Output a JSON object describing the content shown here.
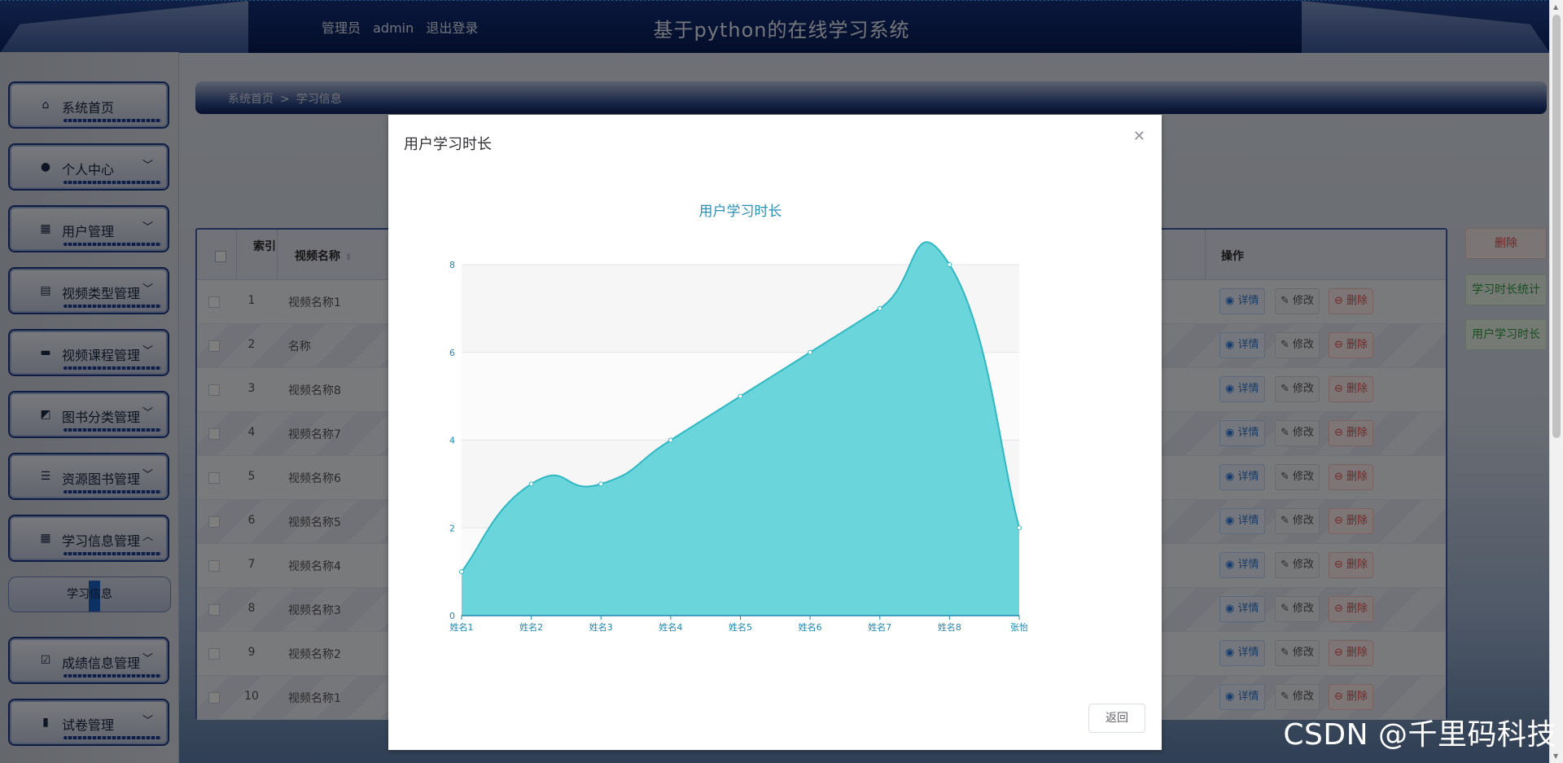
{
  "header": {
    "role": "管理员",
    "username": "admin",
    "logout": "退出登录",
    "title": "基于python的在线学习系统"
  },
  "sidebar": {
    "items": [
      {
        "label": "系统首页",
        "icon": "home-icon",
        "arrow": ""
      },
      {
        "label": "个人中心",
        "icon": "user-icon",
        "arrow": "﹀"
      },
      {
        "label": "用户管理",
        "icon": "grid-icon",
        "arrow": "﹀"
      },
      {
        "label": "视频类型管理",
        "icon": "clipboard-icon",
        "arrow": "﹀"
      },
      {
        "label": "视频课程管理",
        "icon": "monitor-icon",
        "arrow": "﹀"
      },
      {
        "label": "图书分类管理",
        "icon": "chart-icon",
        "arrow": "﹀"
      },
      {
        "label": "资源图书管理",
        "icon": "list-icon",
        "arrow": "﹀"
      },
      {
        "label": "学习信息管理",
        "icon": "grid-icon",
        "arrow": "︿"
      },
      {
        "label": "成绩信息管理",
        "icon": "check-clipboard-icon",
        "arrow": "﹀"
      },
      {
        "label": "试卷管理",
        "icon": "bar-chart-icon",
        "arrow": "﹀"
      }
    ],
    "active_sub": "学习信息"
  },
  "breadcrumb": {
    "home": "系统首页",
    "sep": ">",
    "current": "学习信息"
  },
  "table": {
    "columns": {
      "index": "索引",
      "name": "视频名称",
      "ops": "操作"
    },
    "rows": [
      {
        "index": "1",
        "name": "视频名称1"
      },
      {
        "index": "2",
        "name": "名称"
      },
      {
        "index": "3",
        "name": "视频名称8"
      },
      {
        "index": "4",
        "name": "视频名称7"
      },
      {
        "index": "5",
        "name": "视频名称6"
      },
      {
        "index": "6",
        "name": "视频名称5"
      },
      {
        "index": "7",
        "name": "视频名称4"
      },
      {
        "index": "8",
        "name": "视频名称3"
      },
      {
        "index": "9",
        "name": "视频名称2"
      },
      {
        "index": "10",
        "name": "视频名称1"
      }
    ],
    "actions": {
      "detail": "详情",
      "edit": "修改",
      "delete": "删除"
    }
  },
  "side_buttons": {
    "delete": "删除",
    "stats": "学习时长统计",
    "user_duration": "用户学习时长"
  },
  "dialog": {
    "title": "用户学习时长",
    "back_button": "返回"
  },
  "chart_data": {
    "type": "area",
    "title": "用户学习时长",
    "categories": [
      "姓名1",
      "姓名2",
      "姓名3",
      "姓名4",
      "姓名5",
      "姓名6",
      "姓名7",
      "姓名8",
      "张怡"
    ],
    "values": [
      1,
      3,
      3,
      4,
      5,
      6,
      7,
      8,
      2
    ],
    "ylim": [
      0,
      8
    ],
    "yticks": [
      "0",
      "2",
      "4",
      "6",
      "8"
    ],
    "grid": true,
    "smooth": true,
    "colors": {
      "fill": "#6ad6db",
      "line": "#2fb8c2",
      "title": "#2a8fb4",
      "axis": "#1f86b0"
    }
  },
  "watermark": "CSDN @千里码科技"
}
